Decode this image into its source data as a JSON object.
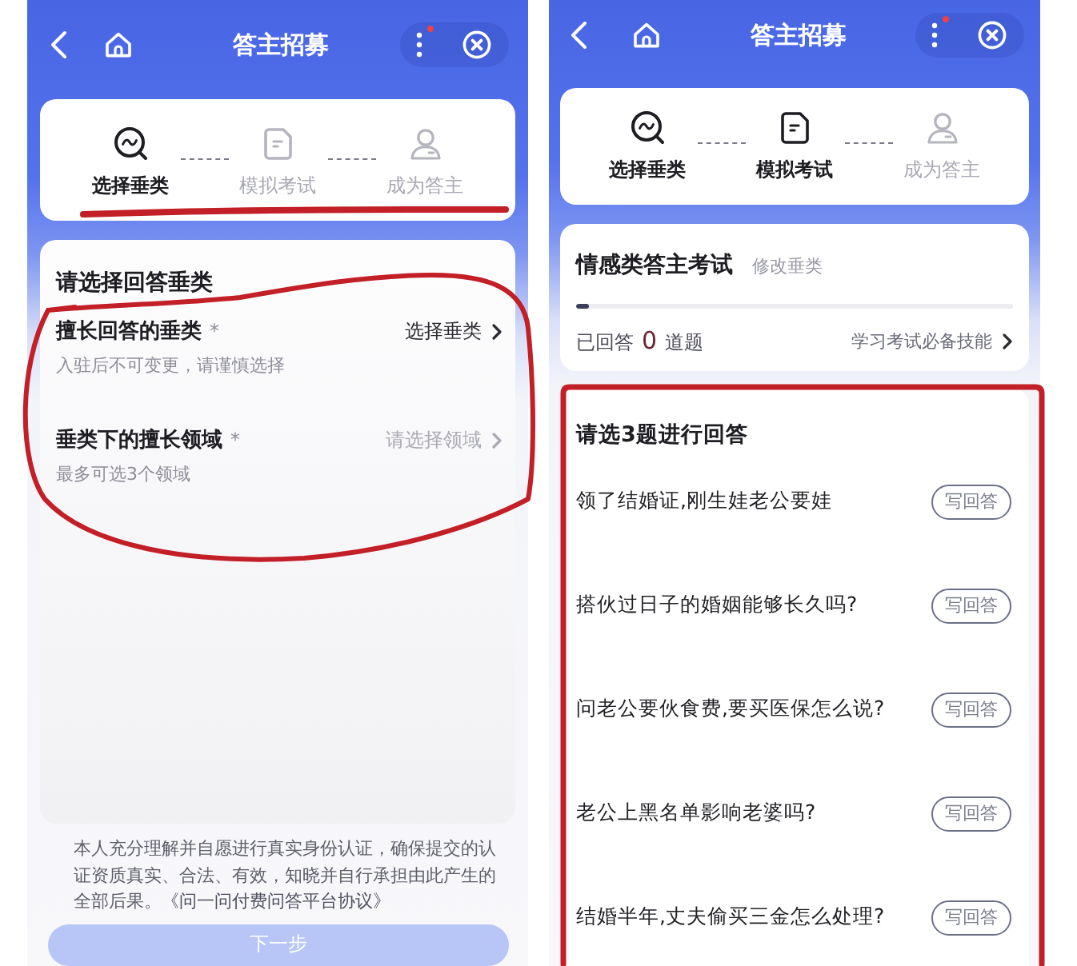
{
  "screens": [
    {
      "kind": "category",
      "header": {
        "title": "答主招募",
        "notification_dot": true
      },
      "steps": [
        {
          "label": "选择垂类",
          "active": true
        },
        {
          "label": "模拟考试",
          "active": false
        },
        {
          "label": "成为答主",
          "active": false
        }
      ],
      "form": {
        "title": "请选择回答垂类",
        "fields": [
          {
            "label": "擅长回答的垂类",
            "required_mark": "*",
            "action": "选择垂类",
            "disabled": false,
            "hint": "入驻后不可变更，请谨慎选择"
          },
          {
            "label": "垂类下的擅长领域",
            "required_mark": "*",
            "action": "请选择领域",
            "disabled": true,
            "hint": "最多可选3个领域"
          }
        ]
      },
      "agreement": {
        "text": "本人充分理解并自愿进行真实身份认证，确保提交的认证资质真实、合法、有效，知晓并自行承担由此产生的全部后果。",
        "link": "《问一问付费问答平台协议》"
      },
      "next_button": {
        "label": "下一步",
        "disabled": true
      },
      "annotations": [
        {
          "kind": "underline"
        },
        {
          "kind": "loop"
        }
      ]
    },
    {
      "kind": "exam",
      "header": {
        "title": "答主招募",
        "notification_dot": true
      },
      "steps": [
        {
          "label": "选择垂类",
          "active": true
        },
        {
          "label": "模拟考试",
          "active": true
        },
        {
          "label": "成为答主",
          "active": false
        }
      ],
      "exam": {
        "title": "情感类答主考试",
        "change_link": "修改垂类",
        "level": 0.03,
        "answered_label": "已回答",
        "answered_count": "0",
        "answered_unit": "道题",
        "skills_link": "学习考试必备技能"
      },
      "questions": {
        "title": "请选3题进行回答",
        "items": [
          {
            "text": "领了结婚证,刚生娃老公要娃",
            "button": "写回答"
          },
          {
            "text": "搭伙过日子的婚姻能够长久吗?",
            "button": "写回答"
          },
          {
            "text": "问老公要伙食费,要买医保怎么说?",
            "button": "写回答"
          },
          {
            "text": "老公上黑名单影响老婆吗?",
            "button": "写回答"
          },
          {
            "text": "结婚半年,丈夫偷买三金怎么处理?",
            "button": "写回答"
          }
        ]
      },
      "annotations": [
        {
          "kind": "frame"
        }
      ]
    }
  ]
}
